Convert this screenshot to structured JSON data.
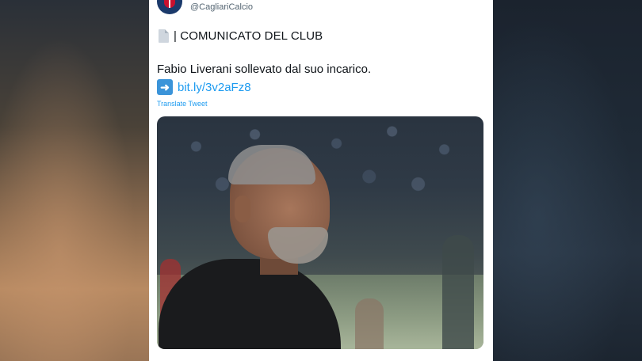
{
  "tweet": {
    "handle": "@CagliariCalcio",
    "title_icon": "page-facing-up-icon",
    "title": "| COMUNICATO DEL CLUB",
    "text": "Fabio Liverani sollevato dal suo incarico.",
    "link_icon": "right-arrow-icon",
    "link": "bit.ly/3v2aFz8",
    "translate_label": "Translate Tweet"
  },
  "colors": {
    "link": "#1d9bf0",
    "text": "#0f1419",
    "secondary": "#536471"
  }
}
